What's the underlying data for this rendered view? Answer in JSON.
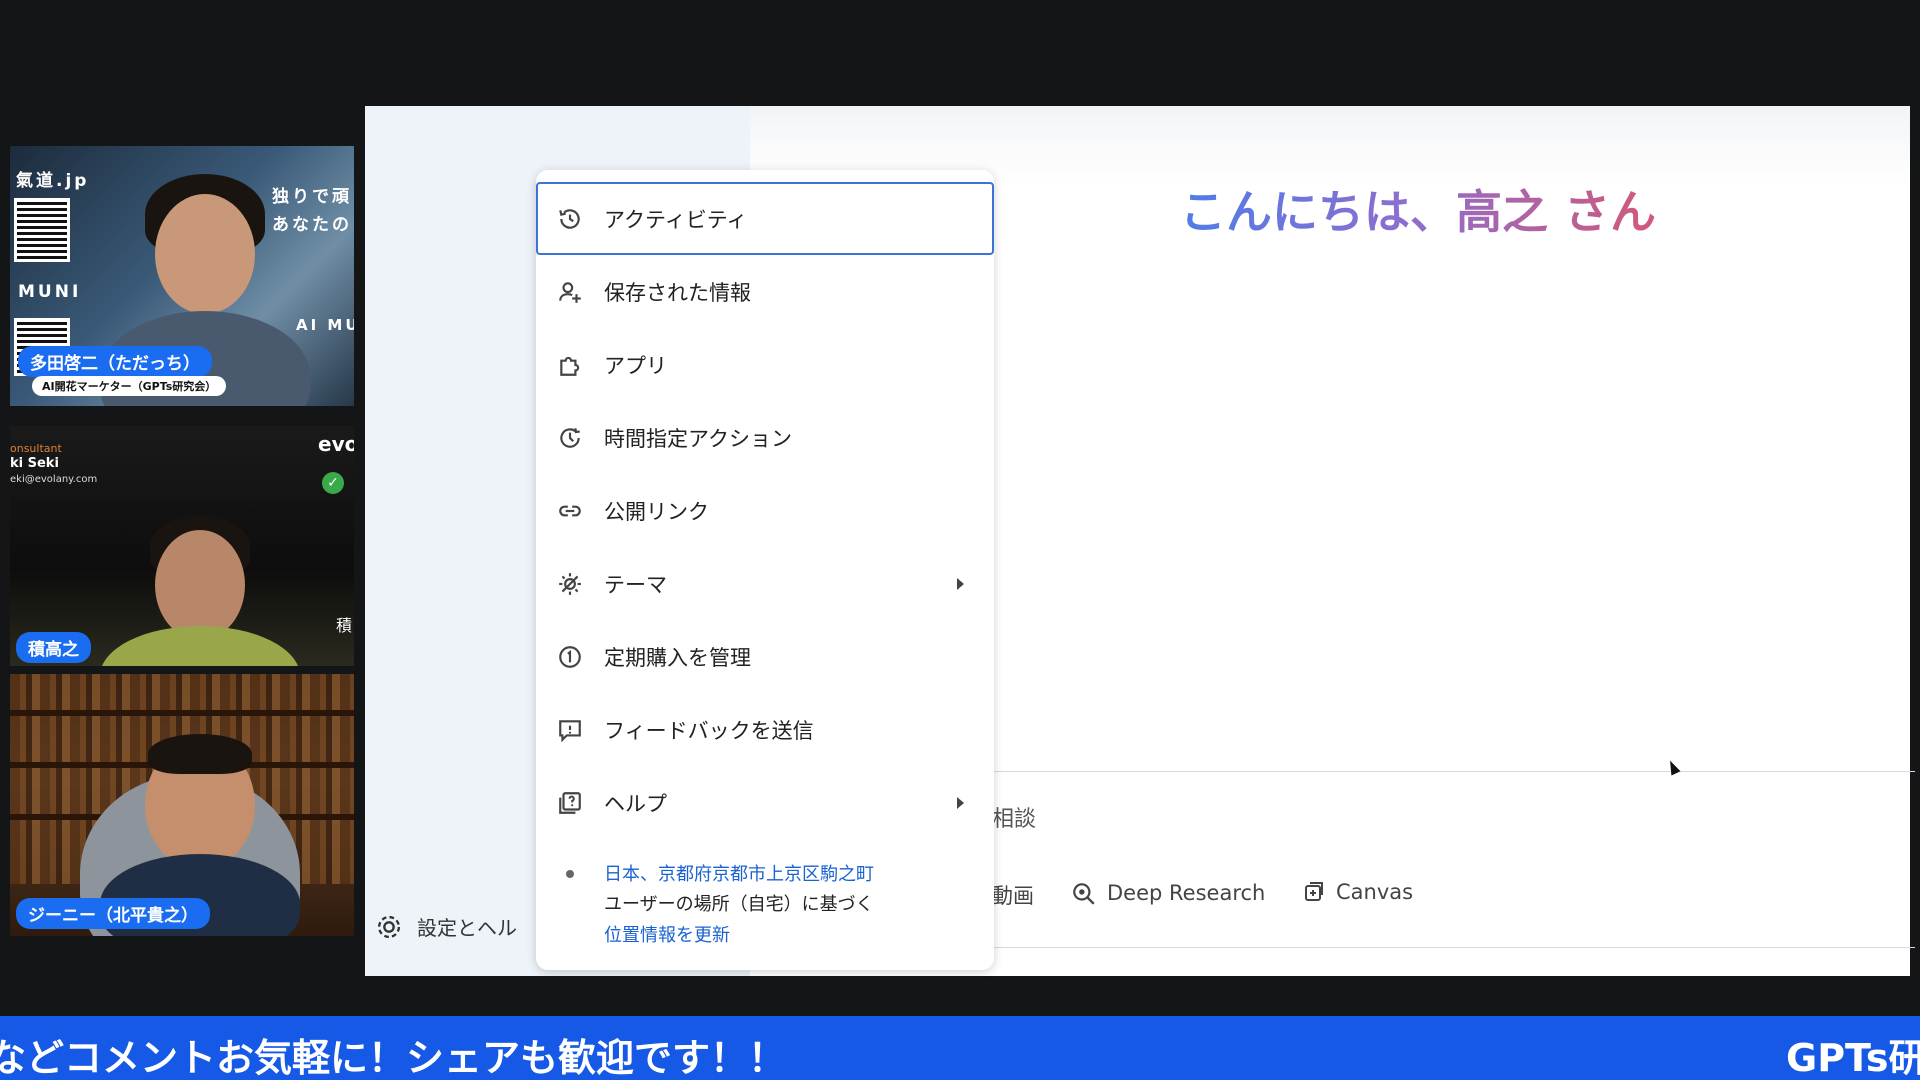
{
  "participants": [
    {
      "name": "多田啓二（ただっち）",
      "subtitle": "AI開花マーケター（GPTs研究会）",
      "overlay": {
        "brand": "氣道.jp",
        "muni": "MUNI",
        "tagline1": "独りで頑",
        "tagline2": "あなたの",
        "ai_mu": "AI MU"
      }
    },
    {
      "name": "積高之",
      "overlay": {
        "role": "onsultant",
        "person": "ki Seki",
        "email": "eki@evolany.com",
        "brand": "evo",
        "initial": "積"
      }
    },
    {
      "name": "ジーニー（北平貴之）"
    }
  ],
  "menu": {
    "items": [
      {
        "label": "アクティビティ",
        "icon": "history-icon",
        "active": true
      },
      {
        "label": "保存された情報",
        "icon": "person-add-icon"
      },
      {
        "label": "アプリ",
        "icon": "puzzle-icon"
      },
      {
        "label": "時間指定アクション",
        "icon": "scheduled-icon"
      },
      {
        "label": "公開リンク",
        "icon": "link-icon"
      },
      {
        "label": "テーマ",
        "icon": "theme-icon",
        "has_submenu": true
      },
      {
        "label": "定期購入を管理",
        "icon": "subscription-icon"
      },
      {
        "label": "フィードバックを送信",
        "icon": "feedback-icon"
      },
      {
        "label": "ヘルプ",
        "icon": "help-icon",
        "has_submenu": true
      }
    ],
    "location": {
      "place": "日本、京都府京都市上京区駒之町",
      "basis": "ユーザーの場所（自宅）に基づく",
      "update_link": "位置情報を更新"
    }
  },
  "gemini": {
    "greeting": "こんにちは、高之 さん",
    "input_partial": "相談",
    "tools": [
      {
        "label": "動画",
        "icon": "video-icon"
      },
      {
        "label": "Deep Research",
        "icon": "deep-research-icon"
      },
      {
        "label": "Canvas",
        "icon": "canvas-icon"
      }
    ],
    "settings_label": "設定とヘル",
    "greeting_colors": [
      "#4f7ce8",
      "#8a6fd0",
      "#d1597a"
    ]
  },
  "ticker": {
    "text": "などコメントお気軽に！シェアも歓迎です！！",
    "brand": "GPTs研"
  }
}
